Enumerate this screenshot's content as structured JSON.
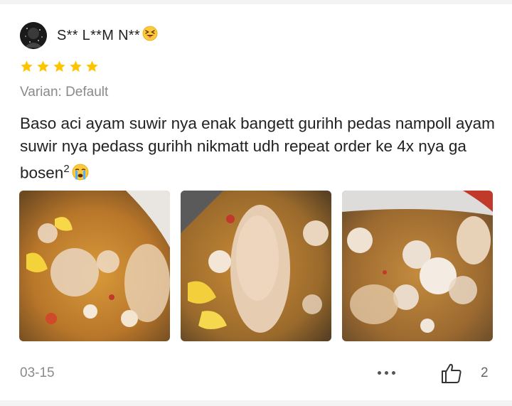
{
  "review": {
    "username": "S** L**M N**",
    "username_emoji": "squinting-face-with-tongue",
    "rating": 5,
    "rating_max": 5,
    "variant_label": "Varian: Default",
    "text_main": "Baso aci ayam suwir nya enak bangett gurihh pedas nampoll ayam suwir nya pedass gurihh nikmatt udh repeat order ke 4x nya ga bosen",
    "text_superscript": "2",
    "text_emoji": "loudly-crying-face",
    "photos": [
      {
        "name": "review-photo-1"
      },
      {
        "name": "review-photo-2"
      },
      {
        "name": "review-photo-3"
      }
    ],
    "date": "03-15",
    "like_count": "2"
  },
  "colors": {
    "star": "#FFC400",
    "muted_text": "#8A8A8A",
    "body_text": "#222222"
  },
  "icons": {
    "more": "more-dots-icon",
    "like": "thumbs-up-icon"
  }
}
